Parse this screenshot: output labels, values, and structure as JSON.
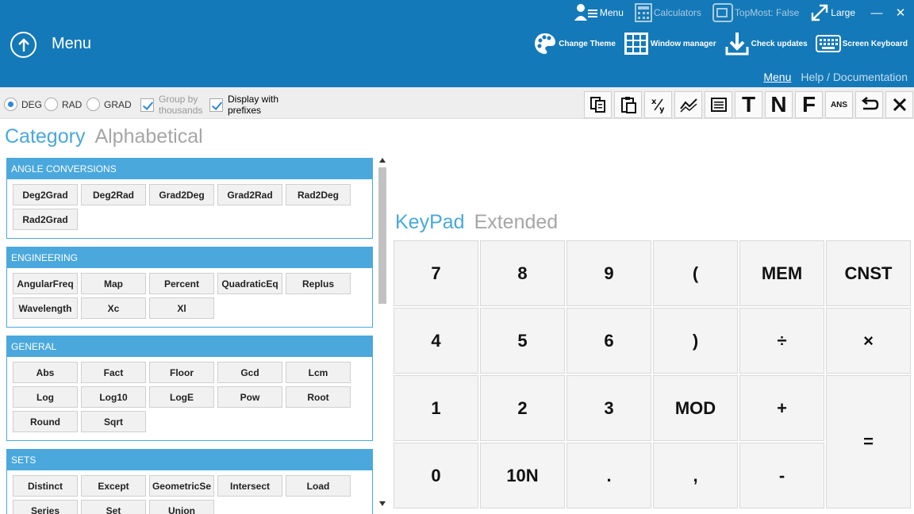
{
  "header": {
    "title": "Menu",
    "top_items": [
      {
        "label": "Menu",
        "icon": "user-menu-icon"
      },
      {
        "label": "Calculators",
        "icon": "calculator-icon"
      },
      {
        "label": "TopMost: False",
        "icon": "window-icon"
      },
      {
        "label": "Large",
        "icon": "resize-icon"
      }
    ],
    "window_controls": {
      "minimize": "—",
      "close": "✕"
    },
    "actions": [
      {
        "label": "Change Theme",
        "icon": "palette-icon"
      },
      {
        "label": "Window manager",
        "icon": "grid-icon"
      },
      {
        "label": "Check updates",
        "icon": "download-icon"
      },
      {
        "label": "Screen Keyboard",
        "icon": "keyboard-icon"
      }
    ],
    "menu_link": "Menu",
    "help_link": "Help / Documentation"
  },
  "toolbar": {
    "angle_modes": [
      "DEG",
      "RAD",
      "GRAD"
    ],
    "selected_angle_mode": "DEG",
    "group_by_thousands": {
      "line1": "Group by",
      "line2": "thousands"
    },
    "display_prefixes": {
      "line1": "Display with",
      "line2": "prefixes"
    },
    "text_buttons": {
      "t": "T",
      "n": "N",
      "f": "F",
      "ans": "ANS"
    }
  },
  "left_tabs": {
    "active": "Category",
    "inactive": "Alphabetical"
  },
  "categories": [
    {
      "name": "ANGLE CONVERSIONS",
      "functions": [
        "Deg2Grad",
        "Deg2Rad",
        "Grad2Deg",
        "Grad2Rad",
        "Rad2Deg",
        "Rad2Grad"
      ]
    },
    {
      "name": "ENGINEERING",
      "functions": [
        "AngularFreq",
        "Map",
        "Percent",
        "QuadraticEq",
        "Replus",
        "Wavelength",
        "Xc",
        "Xl"
      ]
    },
    {
      "name": "GENERAL",
      "functions": [
        "Abs",
        "Fact",
        "Floor",
        "Gcd",
        "Lcm",
        "Log",
        "Log10",
        "LogE",
        "Pow",
        "Root",
        "Round",
        "Sqrt"
      ]
    },
    {
      "name": "SETS",
      "functions": [
        "Distinct",
        "Except",
        "GeometricSe",
        "Intersect",
        "Load",
        "Series",
        "Set",
        "Union"
      ]
    }
  ],
  "right_tabs": {
    "active": "KeyPad",
    "inactive": "Extended"
  },
  "keypad": {
    "k7": "7",
    "k8": "8",
    "k9": "9",
    "lparen": "(",
    "mem": "MEM",
    "cnst": "CNST",
    "k4": "4",
    "k5": "5",
    "k6": "6",
    "rparen": ")",
    "divide": "÷",
    "multiply": "×",
    "k1": "1",
    "k2": "2",
    "k3": "3",
    "mod": "MOD",
    "plus": "+",
    "equals": "=",
    "k0": "0",
    "ten_n": "10N",
    "dot": ".",
    "comma": ",",
    "minus": "-"
  }
}
